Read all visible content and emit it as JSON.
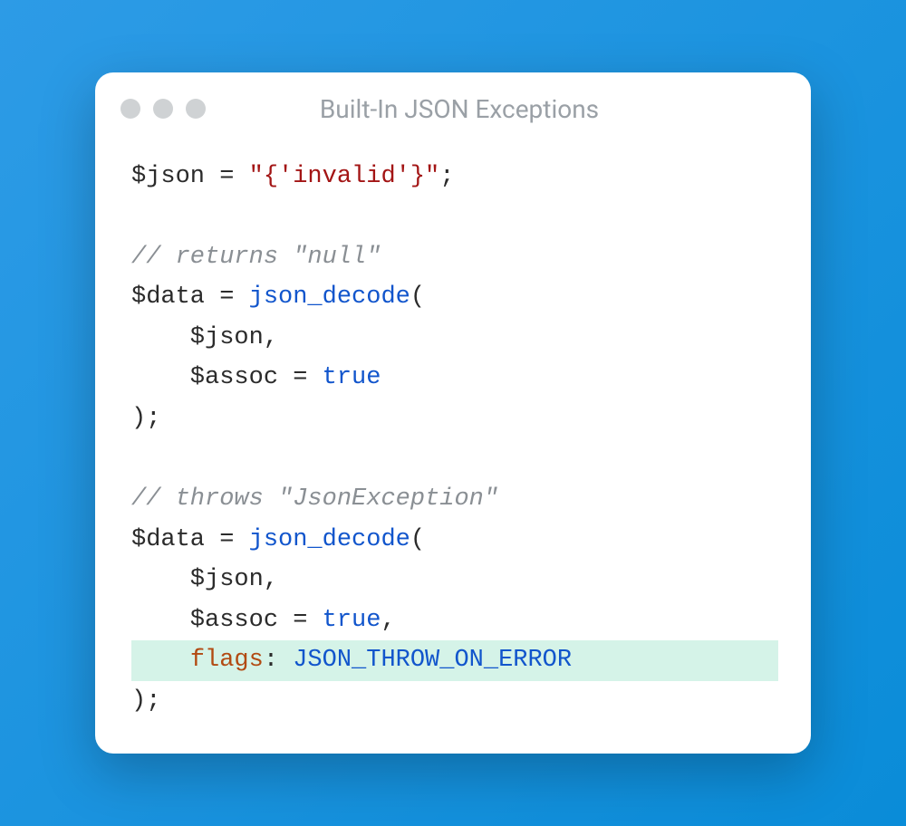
{
  "window": {
    "title": "Built-In JSON Exceptions"
  },
  "code": {
    "lines": [
      {
        "hl": false,
        "tokens": [
          {
            "t": "$json ",
            "c": "tok-default"
          },
          {
            "t": "=",
            "c": "tok-operator"
          },
          {
            "t": " ",
            "c": "tok-default"
          },
          {
            "t": "\"{'invalid'}\"",
            "c": "tok-string"
          },
          {
            "t": ";",
            "c": "tok-default"
          }
        ]
      },
      {
        "hl": false,
        "tokens": [
          {
            "t": " ",
            "c": "tok-default"
          }
        ]
      },
      {
        "hl": false,
        "tokens": [
          {
            "t": "// returns \"null\"",
            "c": "tok-comment"
          }
        ]
      },
      {
        "hl": false,
        "tokens": [
          {
            "t": "$data ",
            "c": "tok-default"
          },
          {
            "t": "=",
            "c": "tok-operator"
          },
          {
            "t": " ",
            "c": "tok-default"
          },
          {
            "t": "json_decode",
            "c": "tok-func"
          },
          {
            "t": "(",
            "c": "tok-default"
          }
        ]
      },
      {
        "hl": false,
        "tokens": [
          {
            "t": "    $json,",
            "c": "tok-default"
          }
        ]
      },
      {
        "hl": false,
        "tokens": [
          {
            "t": "    $assoc ",
            "c": "tok-default"
          },
          {
            "t": "=",
            "c": "tok-operator"
          },
          {
            "t": " ",
            "c": "tok-default"
          },
          {
            "t": "true",
            "c": "tok-keyword"
          }
        ]
      },
      {
        "hl": false,
        "tokens": [
          {
            "t": ");",
            "c": "tok-default"
          }
        ]
      },
      {
        "hl": false,
        "tokens": [
          {
            "t": " ",
            "c": "tok-default"
          }
        ]
      },
      {
        "hl": false,
        "tokens": [
          {
            "t": "// throws \"JsonException\"",
            "c": "tok-comment"
          }
        ]
      },
      {
        "hl": false,
        "tokens": [
          {
            "t": "$data ",
            "c": "tok-default"
          },
          {
            "t": "=",
            "c": "tok-operator"
          },
          {
            "t": " ",
            "c": "tok-default"
          },
          {
            "t": "json_decode",
            "c": "tok-func"
          },
          {
            "t": "(",
            "c": "tok-default"
          }
        ]
      },
      {
        "hl": false,
        "tokens": [
          {
            "t": "    $json,",
            "c": "tok-default"
          }
        ]
      },
      {
        "hl": false,
        "tokens": [
          {
            "t": "    $assoc ",
            "c": "tok-default"
          },
          {
            "t": "=",
            "c": "tok-operator"
          },
          {
            "t": " ",
            "c": "tok-default"
          },
          {
            "t": "true",
            "c": "tok-keyword"
          },
          {
            "t": ",",
            "c": "tok-default"
          }
        ]
      },
      {
        "hl": true,
        "tokens": [
          {
            "t": "    ",
            "c": "tok-default"
          },
          {
            "t": "flags",
            "c": "tok-param"
          },
          {
            "t": ": ",
            "c": "tok-default"
          },
          {
            "t": "JSON_THROW_ON_ERROR",
            "c": "tok-const"
          }
        ]
      },
      {
        "hl": false,
        "tokens": [
          {
            "t": ");",
            "c": "tok-default"
          }
        ]
      }
    ]
  }
}
